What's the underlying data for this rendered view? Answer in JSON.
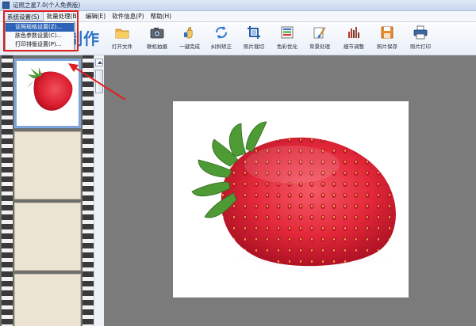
{
  "window": {
    "title": "证照之星7.0(个人免费版)"
  },
  "menu": {
    "items": [
      "系统设置(S)",
      "批量处理(B)",
      "编辑(E)",
      "软件信息(P)",
      "帮助(H)"
    ],
    "active_index": 0
  },
  "dropdown": {
    "items": [
      "证照规格设置(Z)...",
      "肤色参数设置(C)...",
      "打印排版设置(P)..."
    ],
    "highlight_index": 0
  },
  "toolbar": {
    "brand": "制作",
    "tools": [
      {
        "label": "打开文件",
        "icon": "folder-icon"
      },
      {
        "label": "联机拍摄",
        "icon": "camera-icon"
      },
      {
        "label": "一键完成",
        "icon": "hand-icon"
      },
      {
        "label": "纠斜矫正",
        "icon": "rotate-icon"
      },
      {
        "label": "照片裁切",
        "icon": "crop-icon"
      },
      {
        "label": "色彩优化",
        "icon": "color-bars-icon"
      },
      {
        "label": "背景处理",
        "icon": "brush-icon"
      },
      {
        "label": "细节调整",
        "icon": "levels-icon"
      },
      {
        "label": "照片保存",
        "icon": "save-icon"
      },
      {
        "label": "照片打印",
        "icon": "printer-icon"
      }
    ]
  },
  "colors": {
    "accent": "#2f73c8",
    "annotation": "#e11e1e",
    "workspace": "#7b7b7b",
    "strawberry": "#e3283a"
  }
}
